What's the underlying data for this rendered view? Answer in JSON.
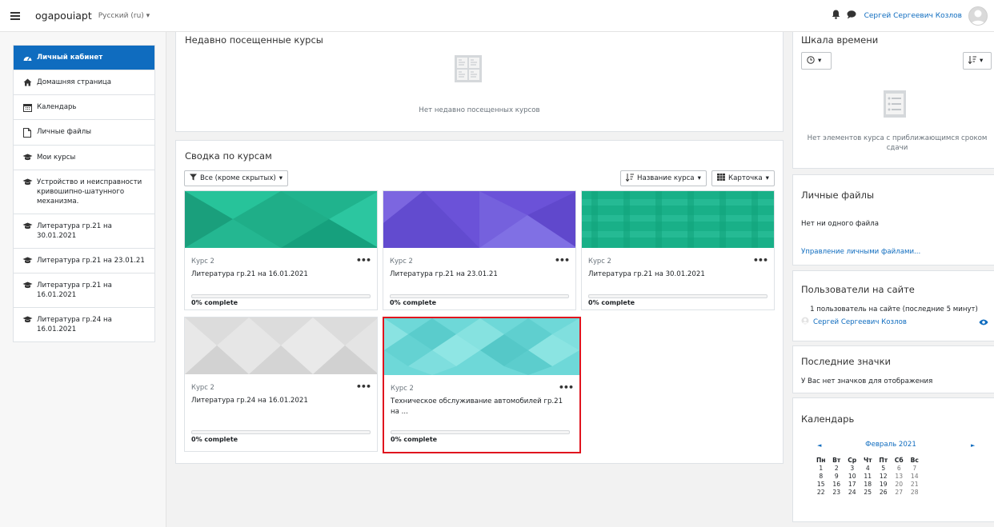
{
  "navbar": {
    "site_name": "ogapouiapt",
    "language": "Русский (ru)",
    "user_name": "Сергей Сергеевич Козлов",
    "caret": "▾"
  },
  "sidebar": {
    "items": [
      {
        "label": "Личный кабинет",
        "icon": "dashboard-icon"
      },
      {
        "label": "Домашняя страница",
        "icon": "home-icon"
      },
      {
        "label": "Календарь",
        "icon": "calendar-icon"
      },
      {
        "label": "Личные файлы",
        "icon": "file-icon"
      },
      {
        "label": "Мои курсы",
        "icon": "graduation-cap-icon"
      },
      {
        "label": "Устройство и неисправности кривошипно-шатунного механизма.",
        "icon": "graduation-cap-icon"
      },
      {
        "label": "Литература гр.21 на 30.01.2021",
        "icon": "graduation-cap-icon"
      },
      {
        "label": "Литература гр.21 на 23.01.21",
        "icon": "graduation-cap-icon"
      },
      {
        "label": "Литература гр.21 на 16.01.2021",
        "icon": "graduation-cap-icon"
      },
      {
        "label": "Литература гр.24 на 16.01.2021",
        "icon": "graduation-cap-icon"
      }
    ]
  },
  "recent": {
    "title": "Недавно посещенные курсы",
    "empty": "Нет недавно посещенных курсов"
  },
  "overview": {
    "title": "Сводка по курсам",
    "filter_label": "Все (кроме скрытых)",
    "sort_label": "Название курса",
    "view_label": "Карточка",
    "courses": [
      {
        "category": "Курс 2",
        "name": "Литература гр.21 на 16.01.2021",
        "progress": "0% complete",
        "color": "#20b38d"
      },
      {
        "category": "Курс 2",
        "name": "Литература гр.21 на 23.01.21",
        "progress": "0% complete",
        "color": "#6b52d8"
      },
      {
        "category": "Курс 2",
        "name": "Литература гр.21 на 30.01.2021",
        "progress": "0% complete",
        "color": "#19b088"
      },
      {
        "category": "Курс 2",
        "name": "Литература гр.24 на 16.01.2021",
        "progress": "0% complete",
        "color": "#dcdcdc"
      },
      {
        "category": "Курс 2",
        "name": "Техническое обслуживание автомобилей гр.21 на ...",
        "progress": "0% complete",
        "color": "#6ed8d8"
      }
    ]
  },
  "timeline": {
    "title": "Шкала времени",
    "empty": "Нет элементов курса с приближающимся сроком сдачи"
  },
  "private_files": {
    "title": "Личные файлы",
    "empty": "Нет ни одного файла",
    "manage_link": "Управление личными файлами..."
  },
  "online_users": {
    "title": "Пользователи на сайте",
    "summary": "1 пользователь на сайте (последние 5 минут)",
    "user": "Сергей Сергеевич Козлов"
  },
  "badges": {
    "title": "Последние значки",
    "empty": "У Вас нет значков для отображения"
  },
  "calendar": {
    "title": "Календарь",
    "month": "Февраль 2021",
    "prev": "◄",
    "next": "►",
    "weekdays": [
      "Пн",
      "Вт",
      "Ср",
      "Чт",
      "Пт",
      "Сб",
      "Вс"
    ],
    "weeks": [
      [
        "1",
        "2",
        "3",
        "4",
        "5",
        "6",
        "7"
      ],
      [
        "8",
        "9",
        "10",
        "11",
        "12",
        "13",
        "14"
      ],
      [
        "15",
        "16",
        "17",
        "18",
        "19",
        "20",
        "21"
      ],
      [
        "22",
        "23",
        "24",
        "25",
        "26",
        "27",
        "28"
      ]
    ]
  },
  "colors": {
    "accent": "#0f6cbf",
    "highlight": "#e0141e"
  }
}
